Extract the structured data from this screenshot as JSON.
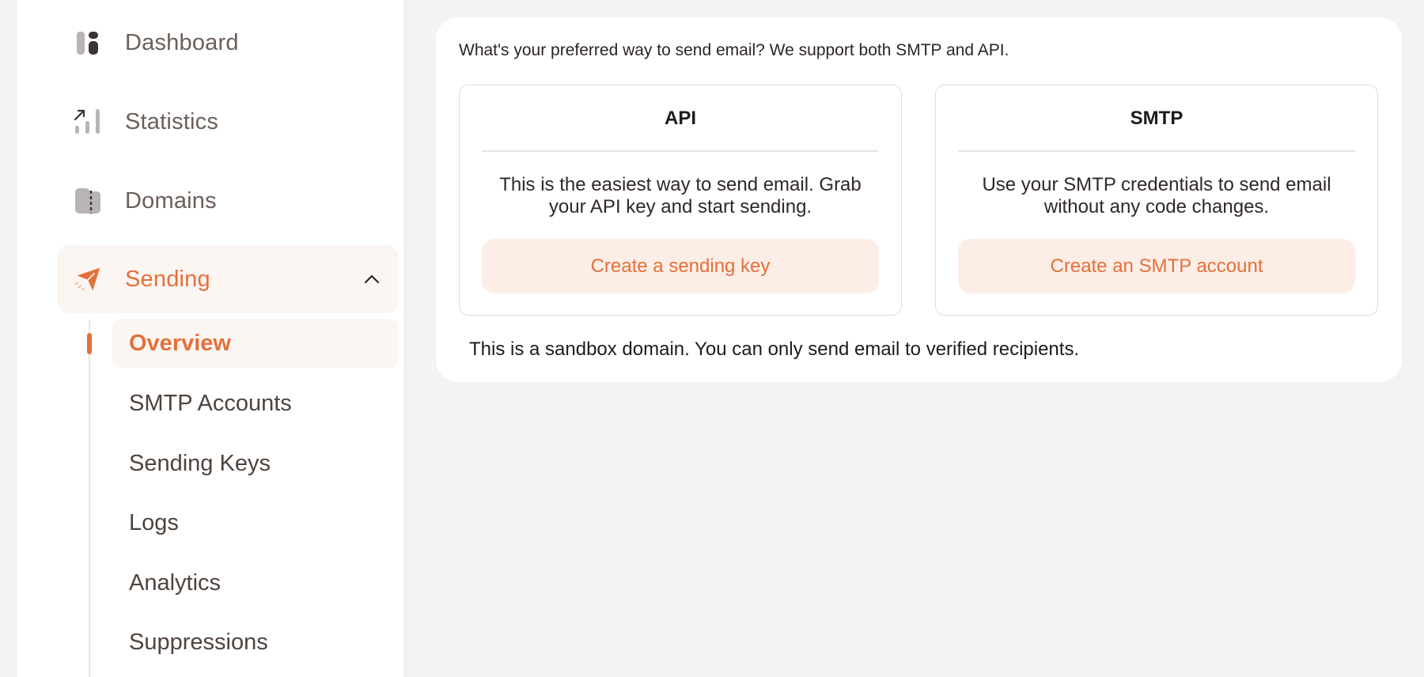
{
  "sidebar": {
    "items": [
      {
        "label": "Dashboard",
        "icon": "dashboard-icon"
      },
      {
        "label": "Statistics",
        "icon": "statistics-icon"
      },
      {
        "label": "Domains",
        "icon": "domains-icon"
      },
      {
        "label": "Sending",
        "icon": "paper-plane-icon",
        "active": true,
        "expanded": true
      }
    ],
    "sending_subitems": [
      {
        "label": "Overview",
        "active": true
      },
      {
        "label": "SMTP Accounts"
      },
      {
        "label": "Sending Keys"
      },
      {
        "label": "Logs"
      },
      {
        "label": "Analytics"
      },
      {
        "label": "Suppressions"
      }
    ]
  },
  "main": {
    "intro": "What's your preferred way to send email? We support both SMTP and API.",
    "options": [
      {
        "title": "API",
        "description": "This is the easiest way to send email. Grab your API key and start sending.",
        "button_label": "Create a sending key"
      },
      {
        "title": "SMTP",
        "description": "Use your SMTP credentials to send email without any code changes.",
        "button_label": "Create an SMTP account"
      }
    ],
    "sandbox_note": "This is a sandbox domain. You can only send email to verified recipients."
  },
  "colors": {
    "accent": "#e4703a",
    "accent_bg": "#fcede6",
    "active_bg": "#fcf6f3",
    "page_bg": "#f5f3f1"
  }
}
